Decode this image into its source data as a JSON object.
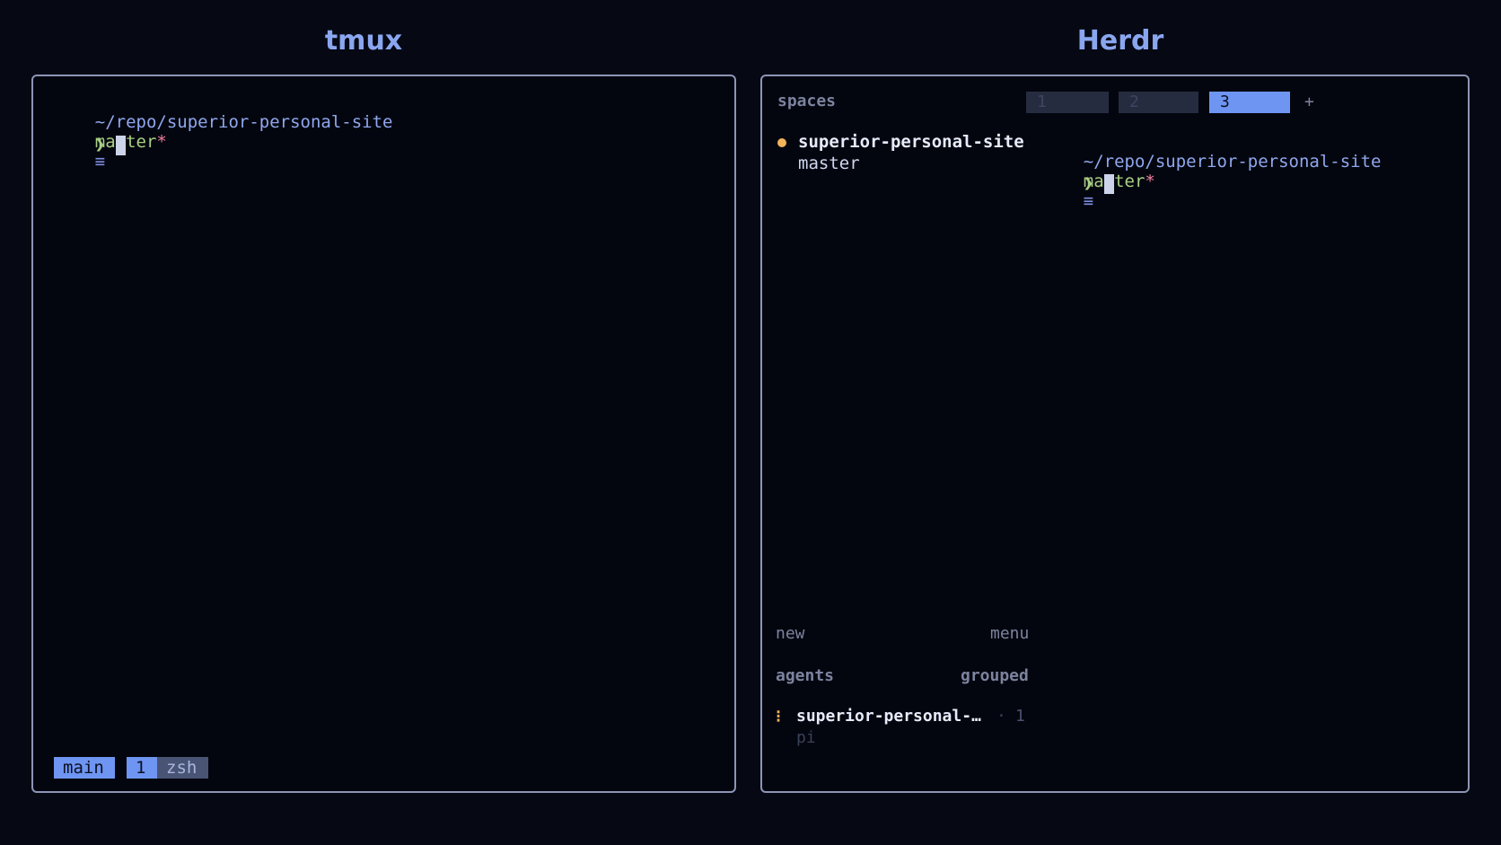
{
  "headings": {
    "left": "tmux",
    "right": "Herdr"
  },
  "tmux": {
    "path": "~/repo/superior-personal-site",
    "branch": "master",
    "dirty_marker": "*",
    "status_icon": "≡",
    "prompt": "❯",
    "statusbar": {
      "session": "main",
      "window_index": "1",
      "window_name": "zsh"
    }
  },
  "herdr": {
    "spaces_label": "spaces",
    "tabs": [
      {
        "label": "1",
        "active": false
      },
      {
        "label": "2",
        "active": false
      },
      {
        "label": "3",
        "active": true
      }
    ],
    "add_tab": "+",
    "space_item": {
      "name": "superior-personal-site",
      "branch": "master"
    },
    "terminal": {
      "path": "~/repo/superior-personal-site",
      "branch": "master",
      "dirty_marker": "*",
      "status_icon": "≡",
      "prompt": "❯"
    },
    "actions": {
      "new": "new",
      "menu": "menu"
    },
    "agents_label": "agents",
    "grouped_label": "grouped",
    "agent_item": {
      "name": "superior-personal-…",
      "separator": "·",
      "count": "1",
      "sub": "pi"
    }
  },
  "colors": {
    "background": "#060914",
    "accent": "#6f95f2",
    "branch": "#a8cf84",
    "dirty": "#f07fa0",
    "dot": "#f2b35a"
  }
}
